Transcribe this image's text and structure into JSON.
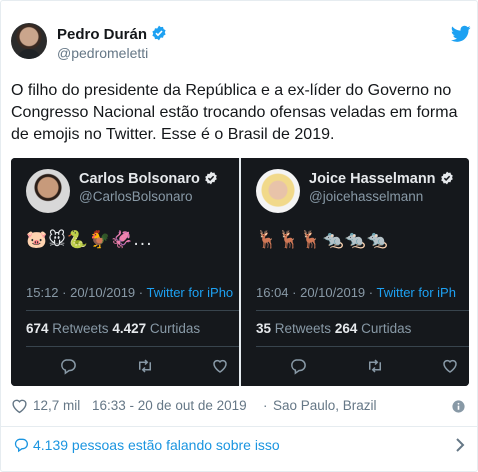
{
  "author": {
    "name": "Pedro Durán",
    "handle": "@pedromeletti"
  },
  "tweet_text": "O filho do presidente da República e a ex-líder do Governo no Congresso Nacional estão trocando ofensas veladas em forma de emojis no Twitter. Esse é o Brasil de 2019.",
  "cards": [
    {
      "name": "Carlos Bolsonaro",
      "handle": "@CarlosBolsonaro",
      "emojis": "🐷🐭🐍🐓🦑...",
      "time": "15:12 · 20/10/2019 · ",
      "source": "Twitter for iPho",
      "retweets": "674",
      "retweets_label": " Retweets ",
      "likes": "4.427",
      "likes_label": " Curtidas"
    },
    {
      "name": "Joice Hasselmann",
      "handle": "@joicehasselmann",
      "emojis": "🦌🦌🦌🐀🐀🐀",
      "time": "16:04 · 20/10/2019 · ",
      "source": "Twitter for iPh",
      "retweets": "35",
      "retweets_label": " Retweets ",
      "likes": "264",
      "likes_label": " Curtidas"
    }
  ],
  "meta": {
    "likes": "12,7 mil",
    "timestamp": "16:33 - 20 de out de 2019",
    "separator": "·",
    "location": "Sao Paulo, Brazil"
  },
  "conversation": "4.139 pessoas estão falando sobre isso",
  "colors": {
    "accent": "#1da1f2",
    "link": "#1b95e0",
    "muted": "#657786",
    "card_bg": "#15181c"
  },
  "icons": {
    "verified": "verified-badge-icon",
    "brand": "twitter-bird-icon",
    "like": "heart-icon",
    "info": "info-icon",
    "reply": "reply-icon",
    "retweet": "retweet-icon",
    "conversation": "speech-bubble-icon",
    "more": "chevron-right-icon"
  }
}
